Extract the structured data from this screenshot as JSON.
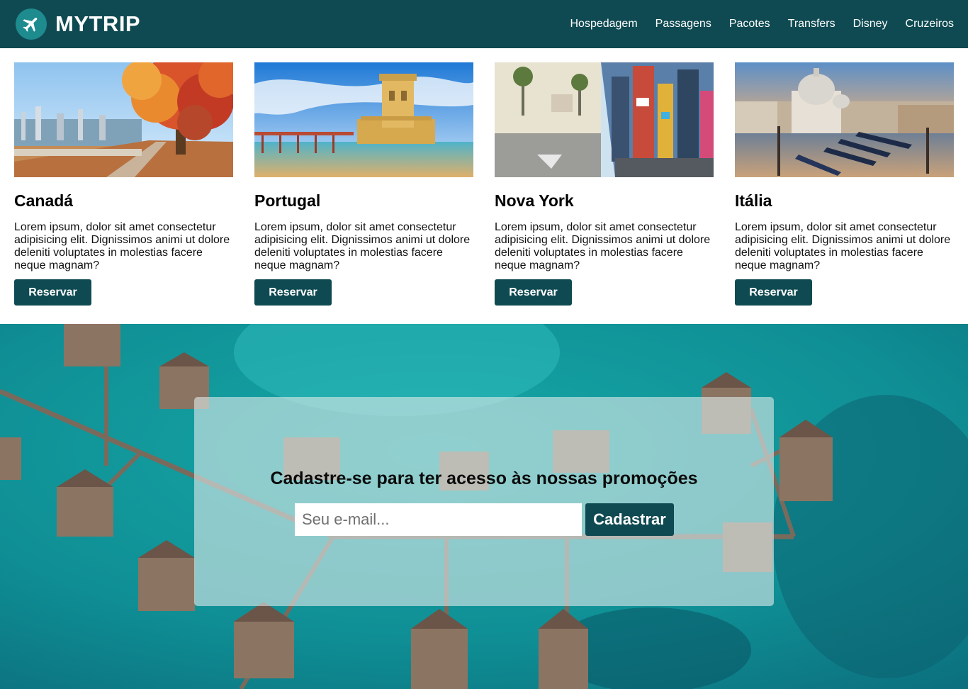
{
  "brand": {
    "name": "MYTRIP",
    "icon": "airplane-icon"
  },
  "colors": {
    "primary": "#0f4a52",
    "accent": "#1e8b8f",
    "sea": "#1aa3a6"
  },
  "nav": {
    "items": [
      {
        "label": "Hospedagem"
      },
      {
        "label": "Passagens"
      },
      {
        "label": "Pacotes"
      },
      {
        "label": "Transfers"
      },
      {
        "label": "Disney"
      },
      {
        "label": "Cruzeiros"
      }
    ]
  },
  "destinations": [
    {
      "title": "Canadá",
      "text": "Lorem ipsum, dolor sit amet consectetur adipisicing elit. Dignissimos animi ut dolore deleniti voluptates in molestias facere neque magnam?",
      "button": "Reservar"
    },
    {
      "title": "Portugal",
      "text": "Lorem ipsum, dolor sit amet consectetur adipisicing elit. Dignissimos animi ut dolore deleniti voluptates in molestias facere neque magnam?",
      "button": "Reservar"
    },
    {
      "title": "Nova York",
      "text": "Lorem ipsum, dolor sit amet consectetur adipisicing elit. Dignissimos animi ut dolore deleniti voluptates in molestias facere neque magnam?",
      "button": "Reservar"
    },
    {
      "title": "Itália",
      "text": "Lorem ipsum, dolor sit amet consectetur adipisicing elit. Dignissimos animi ut dolore deleniti voluptates in molestias facere neque magnam?",
      "button": "Reservar"
    }
  ],
  "signup": {
    "title": "Cadastre-se para ter acesso às nossas promoções",
    "email_placeholder": "Seu e-mail...",
    "email_value": "",
    "button": "Cadastrar"
  }
}
